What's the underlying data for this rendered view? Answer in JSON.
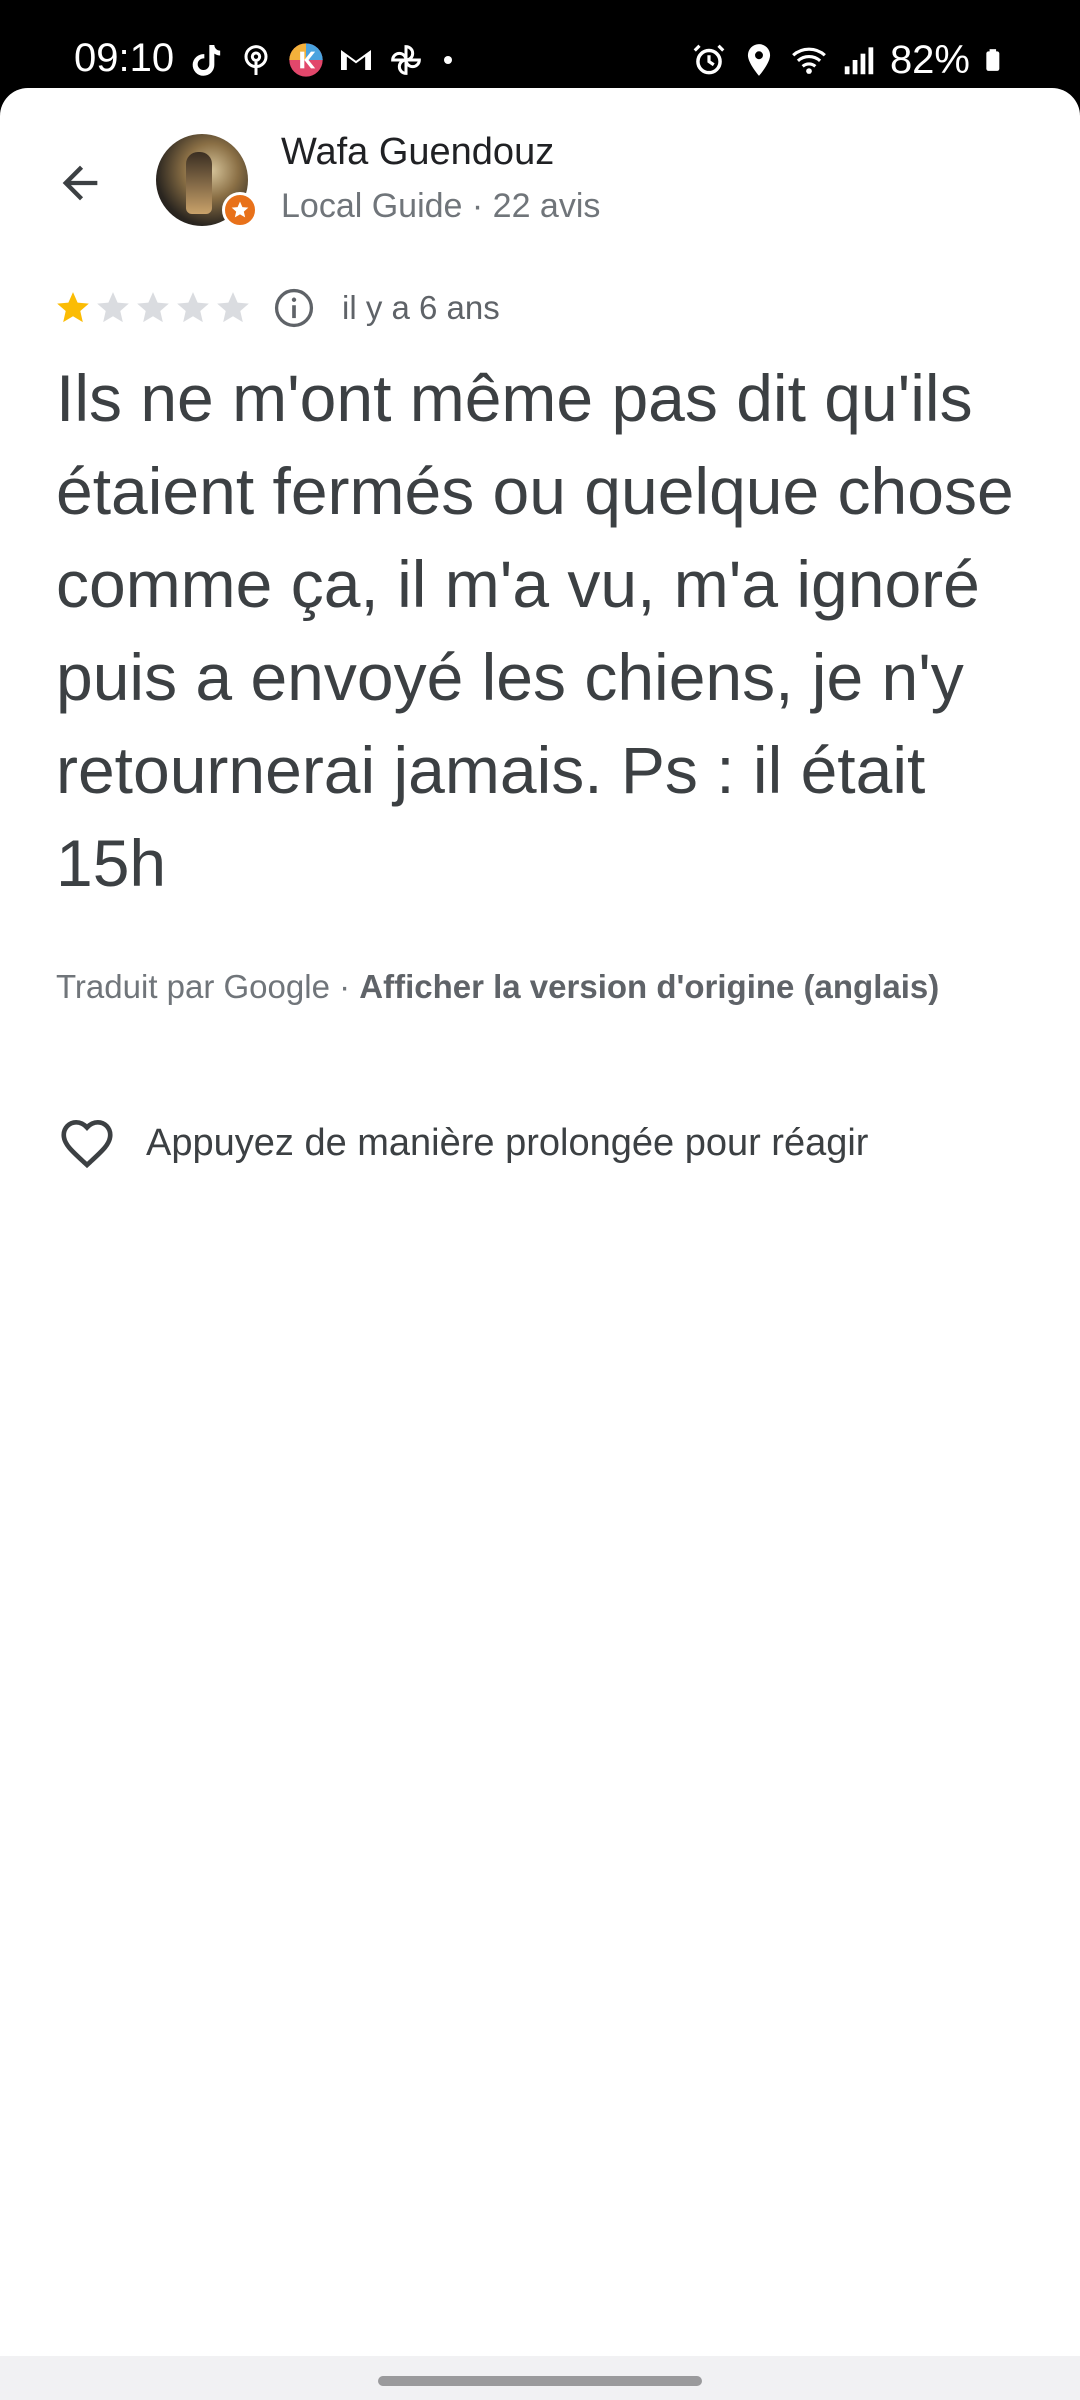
{
  "status_bar": {
    "time": "09:10",
    "battery": "82%",
    "left_icons": [
      "tiktok-icon",
      "podcast-icon",
      "app-icon",
      "gmail-icon",
      "pinwheel-icon",
      "dot-icon"
    ],
    "right_icons": [
      "alarm-icon",
      "location-icon",
      "wifi-icon",
      "signal-icon",
      "battery-icon"
    ]
  },
  "header": {
    "back_icon": "arrow-left-icon",
    "reviewer_name": "Wafa Guendouz",
    "reviewer_meta": "Local Guide · 22 avis",
    "badge_icon": "star-badge-icon"
  },
  "review": {
    "rating": 1,
    "max_rating": 5,
    "date": "il y a 6 ans",
    "text": "Ils ne m'ont même pas dit qu'ils étaient fermés ou quelque chose comme ça, il m'a vu, m'a ignoré puis a envoyé les chiens, je n'y retournerai jamais. Ps : il était 15h",
    "translated_by": "Traduit par Google · ",
    "original_link": "Afficher la version d'origine (anglais)"
  },
  "reaction": {
    "label": "Appuyez de manière prolongée pour réagir",
    "icon": "heart-outline-icon"
  },
  "colors": {
    "star_filled": "#fbbc04",
    "star_empty": "#dadce0",
    "badge": "#e8711a",
    "text_primary": "#202124",
    "text_secondary": "#70757a"
  }
}
